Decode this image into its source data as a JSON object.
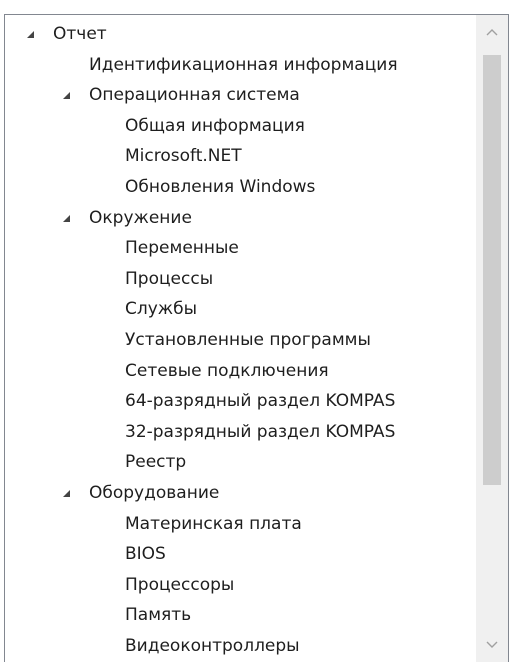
{
  "tree": {
    "items": [
      {
        "label": "Отчет",
        "level": 0,
        "expanded": true
      },
      {
        "label": "Идентификационная информация",
        "level": 1,
        "expanded": false
      },
      {
        "label": "Операционная система",
        "level": 1,
        "expanded": true
      },
      {
        "label": "Общая информация",
        "level": 2,
        "expanded": false
      },
      {
        "label": "Microsoft.NET",
        "level": 2,
        "expanded": false
      },
      {
        "label": "Обновления Windows",
        "level": 2,
        "expanded": false
      },
      {
        "label": "Окружение",
        "level": 1,
        "expanded": true
      },
      {
        "label": "Переменные",
        "level": 2,
        "expanded": false
      },
      {
        "label": "Процессы",
        "level": 2,
        "expanded": false
      },
      {
        "label": "Службы",
        "level": 2,
        "expanded": false
      },
      {
        "label": "Установленные программы",
        "level": 2,
        "expanded": false
      },
      {
        "label": "Сетевые подключения",
        "level": 2,
        "expanded": false
      },
      {
        "label": "64-разрядный раздел KOMPAS",
        "level": 2,
        "expanded": false
      },
      {
        "label": "32-разрядный раздел KOMPAS",
        "level": 2,
        "expanded": false
      },
      {
        "label": "Реестр",
        "level": 2,
        "expanded": false
      },
      {
        "label": "Оборудование",
        "level": 1,
        "expanded": true
      },
      {
        "label": "Материнская плата",
        "level": 2,
        "expanded": false
      },
      {
        "label": "BIOS",
        "level": 2,
        "expanded": false
      },
      {
        "label": "Процессоры",
        "level": 2,
        "expanded": false
      },
      {
        "label": "Память",
        "level": 2,
        "expanded": false
      },
      {
        "label": "Видеоконтроллеры",
        "level": 2,
        "expanded": false
      }
    ]
  },
  "scrollbar": {
    "position": 0.0,
    "visible_fraction": 0.72
  },
  "icons": {
    "expanded": "expanded-triangle-icon",
    "scroll_up": "chevron-up-icon",
    "scroll_down": "chevron-down-icon"
  },
  "colors": {
    "text": "#1e1e1e",
    "border": "#828790",
    "scrollbar_track": "#f0f0f0",
    "scrollbar_thumb": "#cdcdcd",
    "expander": "#444444"
  }
}
